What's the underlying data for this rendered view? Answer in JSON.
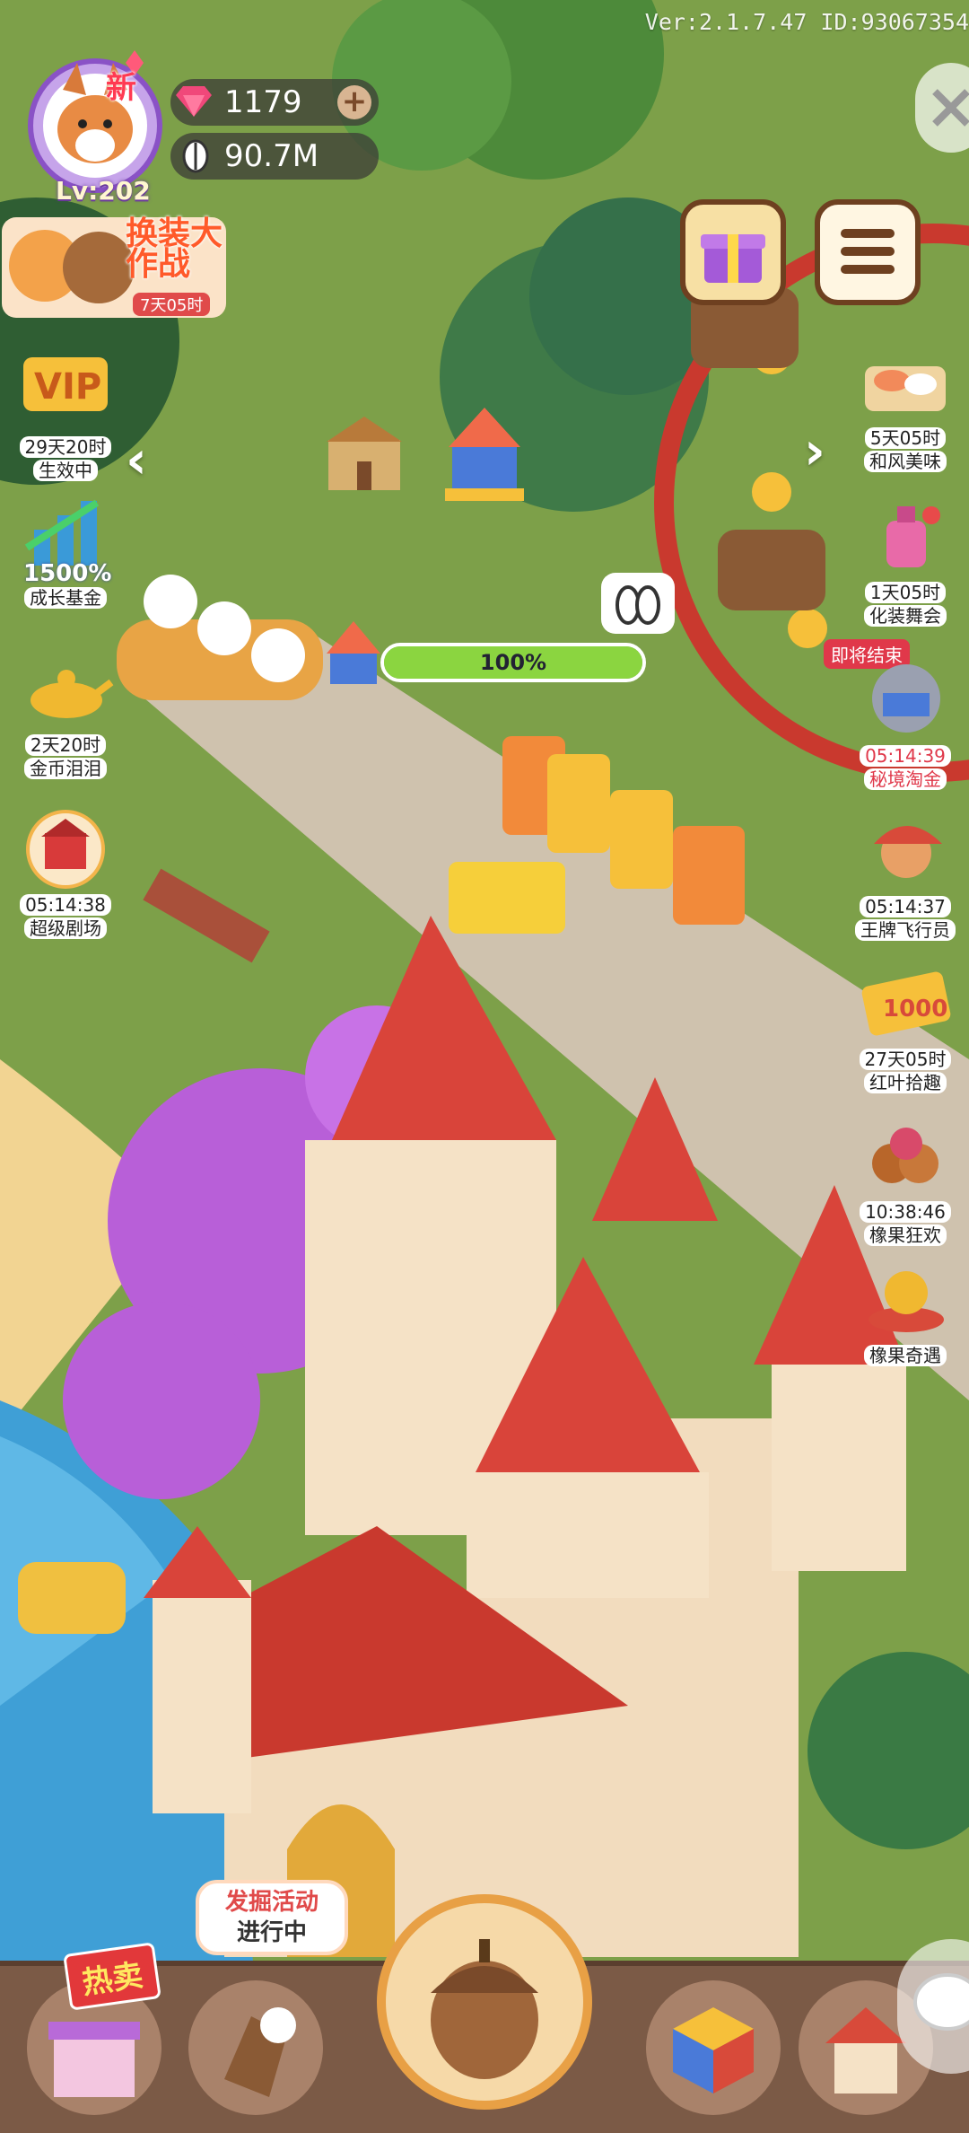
{
  "header": {
    "version": "Ver:2.1.7.47 ID:93067354",
    "level": "Lv:202",
    "new_tag": "新",
    "gems": "1179",
    "seeds": "90.7M"
  },
  "costume_event": {
    "title": "换装大作战",
    "timer": "7天05时"
  },
  "left_side": [
    {
      "name": "vip",
      "timer": "29天20时",
      "label": "生效中"
    },
    {
      "name": "growth-fund",
      "badge": "1500%",
      "label": "成长基金"
    },
    {
      "name": "gold-lamp",
      "timer": "2天20时",
      "label": "金币泪泪"
    },
    {
      "name": "super-theater",
      "timer": "05:14:38",
      "label": "超级剧场"
    }
  ],
  "right_side": [
    {
      "name": "japanese-food",
      "timer": "5天05时",
      "label": "和风美味"
    },
    {
      "name": "makeup",
      "timer": "1天05时",
      "label": "化装舞会"
    },
    {
      "name": "secret-treasure",
      "flag": "即将结束",
      "timer": "05:14:39",
      "label": "秘境淘金"
    },
    {
      "name": "ace-flyer",
      "timer": "05:14:37",
      "label": "王牌飞行员"
    },
    {
      "name": "red-leaves",
      "timer": "27天05时",
      "label": "红叶拾趣"
    },
    {
      "name": "acorn-carnival",
      "timer": "10:38:46",
      "label": "橡果狂欢"
    },
    {
      "name": "acorn-encounter",
      "timer": "",
      "label": "橡果奇遇"
    }
  ],
  "build_progress": {
    "label": "100%",
    "value": 1.0
  },
  "bottom": {
    "hot_label": "热卖",
    "dig_bubble_line1": "发掘活动",
    "dig_bubble_line2": "进行中"
  },
  "colors": {
    "accent": "#e0384a",
    "progress": "#8bd540",
    "bar": "#7b5a46"
  }
}
